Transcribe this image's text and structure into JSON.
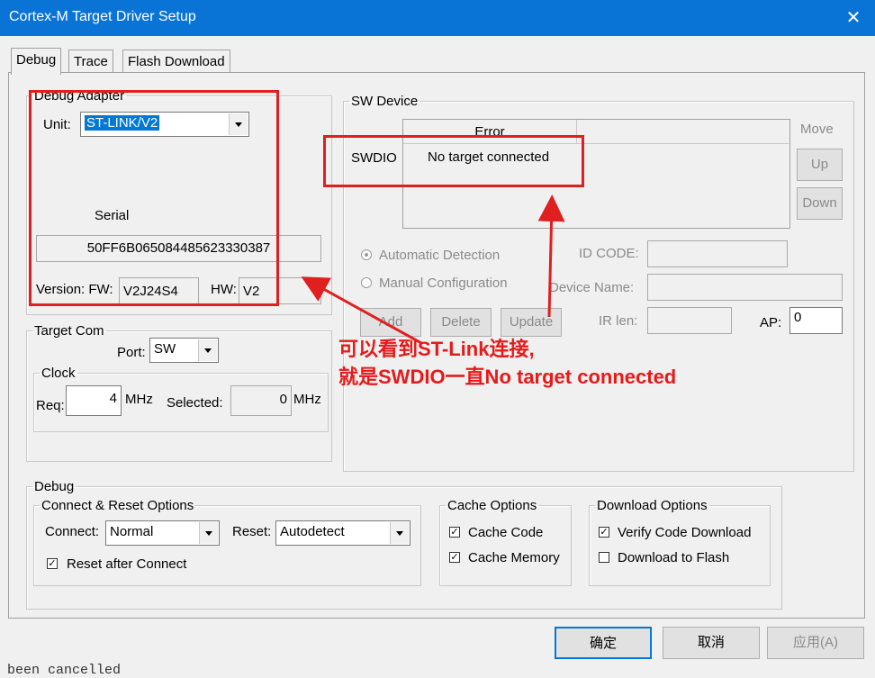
{
  "window": {
    "title": "Cortex-M Target Driver Setup",
    "close_glyph": "✕"
  },
  "tabs": [
    "Debug",
    "Trace",
    "Flash Download"
  ],
  "debug_adapter": {
    "legend": "Debug Adapter",
    "unit_label": "Unit:",
    "unit_value": "ST-LINK/V2",
    "serial_label": "Serial",
    "serial_value": "50FF6B065084485623330387",
    "version_label": "Version: FW:",
    "fw_value": "V2J24S4",
    "hw_label": "HW:",
    "hw_value": "V2"
  },
  "sw_device": {
    "legend": "SW Device",
    "column_header": "Error",
    "row_label": "SWDIO",
    "row_value": "No target connected",
    "move_label": "Move",
    "up_label": "Up",
    "down_label": "Down",
    "automatic_detection": "Automatic Detection",
    "manual_configuration": "Manual Configuration",
    "id_code_label": "ID CODE:",
    "device_name_label": "Device Name:",
    "add_label": "Add",
    "delete_label": "Delete",
    "update_label": "Update",
    "ir_len_label": "IR len:",
    "ap_label": "AP:",
    "ap_value": "0"
  },
  "target_com": {
    "legend": "Target Com",
    "port_label": "Port:",
    "port_value": "SW",
    "clock_legend": "Clock",
    "req_label": "Req:",
    "req_value": "4",
    "req_unit": "MHz",
    "selected_label": "Selected:",
    "selected_value": "0",
    "selected_unit": "MHz"
  },
  "debug": {
    "legend": "Debug",
    "connect_reset_legend": "Connect & Reset Options",
    "connect_label": "Connect:",
    "connect_value": "Normal",
    "reset_label": "Reset:",
    "reset_value": "Autodetect",
    "reset_after_connect": "Reset after Connect",
    "cache_legend": "Cache Options",
    "cache_code": "Cache Code",
    "cache_memory": "Cache Memory",
    "download_legend": "Download Options",
    "verify_code_download": "Verify Code Download",
    "download_to_flash": "Download to Flash"
  },
  "annotation": {
    "line1": "可以看到ST-Link连接,",
    "line2": "就是SWDIO一直No target connected",
    "color": "#e02020"
  },
  "buttons": {
    "ok": "确定",
    "cancel": "取消",
    "apply": "应用(A)"
  },
  "background_text": "been cancelled",
  "check_glyph": "✓"
}
